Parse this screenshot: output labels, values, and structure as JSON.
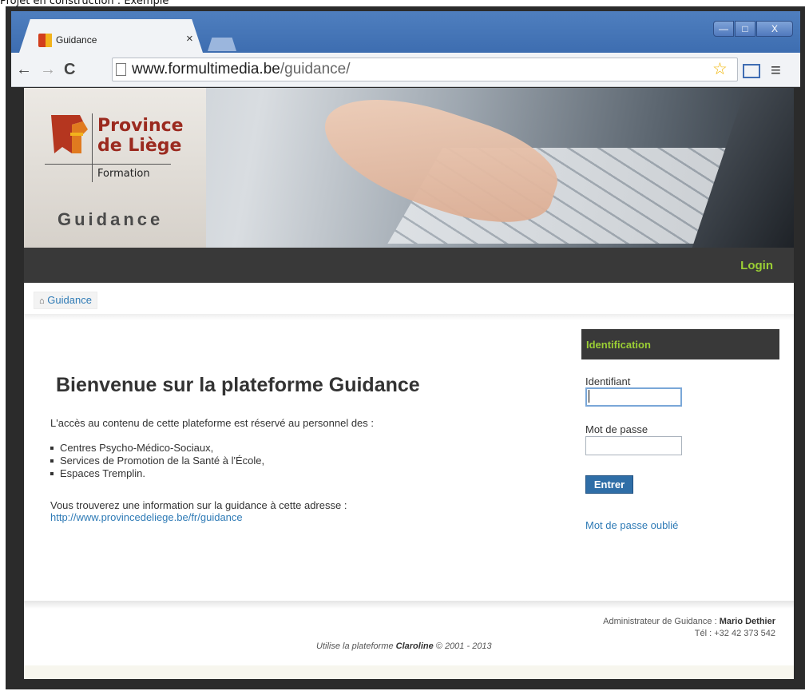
{
  "caption": "Projet en construction : Exemple",
  "browser": {
    "tab_title": "Guidance",
    "tab_close": "×",
    "window_buttons": {
      "minimize": "—",
      "maximize": "□",
      "close": "X"
    },
    "url_host": "www.formultimedia.be",
    "url_path": "/guidance/",
    "nav": {
      "back": "←",
      "forward": "→",
      "reload": "C"
    },
    "icons": {
      "star": "☆",
      "menu": "≡"
    }
  },
  "banner": {
    "logo_line1": "Province",
    "logo_line2": "de Liège",
    "logo_sub": "Formation",
    "title": "Guidance"
  },
  "navbar": {
    "login": "Login"
  },
  "breadcrumb": {
    "home_icon": "⌂",
    "label": "Guidance"
  },
  "main": {
    "title": "Bienvenue sur la plateforme Guidance",
    "intro": "L'accès au contenu de cette plateforme est réservé au personnel des :",
    "items": [
      "Centres Psycho-Médico-Sociaux,",
      "Services de Promotion de la Santé à l'École,",
      "Espaces Tremplin."
    ],
    "info": "Vous trouverez une information sur la guidance à cette adresse :",
    "info_link": "http://www.provincedeliege.be/fr/guidance"
  },
  "login_box": {
    "heading": "Identification",
    "username_label": "Identifiant",
    "username_value": "",
    "password_label": "Mot de passe",
    "password_value": "",
    "submit": "Entrer",
    "forgot": "Mot de passe oublié"
  },
  "footer": {
    "admin_prefix": "Administrateur de Guidance : ",
    "admin_name": "Mario Dethier",
    "tel": "Tél : +32 42 373 542",
    "powered_prefix": "Utilise la plateforme ",
    "powered_name": "Claroline",
    "powered_suffix": " © 2001 - 2013"
  },
  "colors": {
    "accent_green": "#9bcf34",
    "link_blue": "#2f7bb6",
    "dark_bar": "#393939",
    "button_blue": "#2f6ea7",
    "logo_red": "#9b2a1f"
  }
}
